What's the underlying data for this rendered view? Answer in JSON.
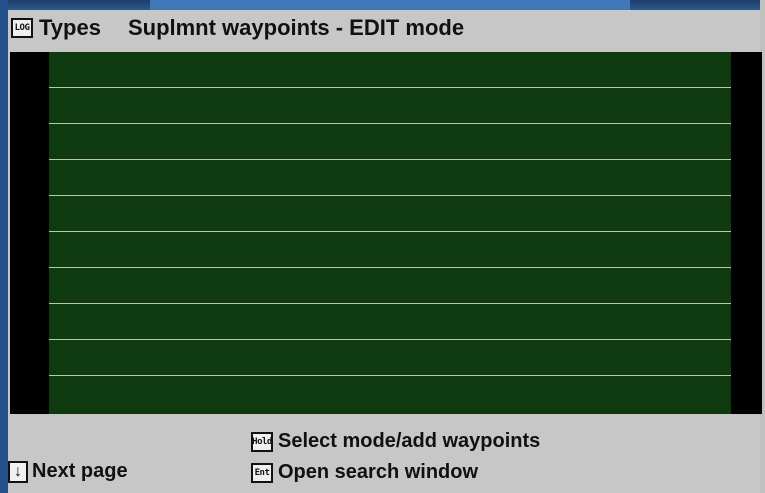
{
  "title_bar": {
    "badge": "LOG",
    "section_label": "Types",
    "mode_label": "Suplmnt waypoints - EDIT mode"
  },
  "waypoint_list": {
    "rows": [
      "",
      "",
      "",
      "",
      "",
      "",
      "",
      "",
      "",
      ""
    ]
  },
  "footer": {
    "next_page": {
      "key_icon": "down-arrow-icon",
      "label": "Next page"
    },
    "select_mode": {
      "key_badge": "Hold",
      "label": "Select mode/add waypoints"
    },
    "open_search": {
      "key_badge": "Ent",
      "label": "Open search window"
    }
  },
  "colors": {
    "screen_bg": "#c7c7c7",
    "list_bg": "#0f3a0f",
    "row_divider": "#b9c8b9",
    "frame_blue": "#245189"
  }
}
